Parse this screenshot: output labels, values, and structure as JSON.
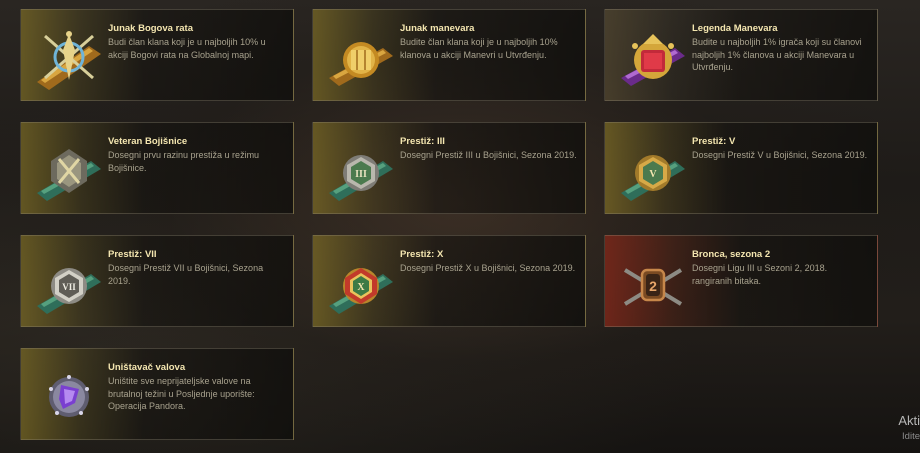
{
  "cards": [
    {
      "title": "Junak Bogova rata",
      "desc": "Budi član klana koji je u najboljih 10% u akciji Bogovi rata na Globalnoj mapi.",
      "icon": "gods-of-war-medal-icon"
    },
    {
      "title": "Junak manevara",
      "desc": "Budite član klana koji je u najboljih 10% klanova u akciji Manevri u Utvrđenju.",
      "icon": "maneuvers-medal-icon"
    },
    {
      "title": "Legenda Manevara",
      "desc": "Budite u najboljih 1% igrača koji su članovi najboljih 1% članova u akciji Manevara u Utvrđenju.",
      "icon": "maneuvers-legend-medal-icon"
    },
    {
      "title": "Veteran Bojišnice",
      "desc": "Dosegni prvu razinu prestiža u režimu Bojišnice.",
      "icon": "frontline-veteran-medal-icon"
    },
    {
      "title": "Prestiž: III",
      "desc": "Dosegni Prestiž III u Bojišnici, Sezona 2019.",
      "icon": "prestige-3-medal-icon"
    },
    {
      "title": "Prestiž: V",
      "desc": "Dosegni Prestiž V u Bojišnici, Sezona 2019.",
      "icon": "prestige-5-medal-icon"
    },
    {
      "title": "Prestiž: VII",
      "desc": "Dosegni Prestiž VII u Bojišnici, Sezona 2019.",
      "icon": "prestige-7-medal-icon"
    },
    {
      "title": "Prestiž: X",
      "desc": "Dosegni Prestiž X u Bojišnici, Sezona 2019.",
      "icon": "prestige-10-medal-icon"
    },
    {
      "title": "Bronca, sezona 2",
      "desc": "Dosegni Ligu III u Sezoni 2, 2018. rangiranih bitaka.",
      "icon": "bronze-season-2-medal-icon"
    },
    {
      "title": "Uništavač valova",
      "desc": "Uništite sve neprijateljske valove na brutalnoj težini u Posljednje uporište: Operacija Pandora.",
      "icon": "wave-destroyer-medal-icon"
    }
  ],
  "medals": {
    "prestige_3": "III",
    "prestige_5": "V",
    "prestige_7": "VII",
    "prestige_10": "X",
    "bronze_rank": "2"
  },
  "watermark": {
    "line1": "Akti",
    "line2": "Idite"
  },
  "colors": {
    "title": "#f4e6b0",
    "desc": "#a8a28e",
    "gold": "#c9a33a"
  }
}
